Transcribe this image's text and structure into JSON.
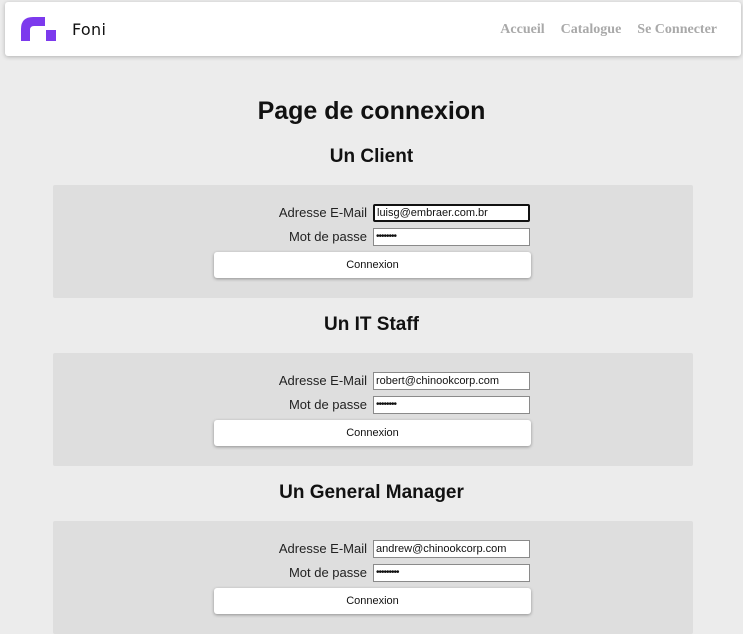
{
  "nav": {
    "brand": "Foni",
    "links": [
      "Accueil",
      "Catalogue",
      "Se Connecter"
    ]
  },
  "page": {
    "title": "Page de connexion"
  },
  "sections": [
    {
      "title": "Un Client",
      "email_label": "Adresse E-Mail",
      "email_value": "luisg@embraer.com.br",
      "password_label": "Mot de passe",
      "password_value": "••••••••",
      "button_label": "Connexion"
    },
    {
      "title": "Un IT Staff",
      "email_label": "Adresse E-Mail",
      "email_value": "robert@chinookcorp.com",
      "password_label": "Mot de passe",
      "password_value": "••••••••",
      "button_label": "Connexion"
    },
    {
      "title": "Un General Manager",
      "email_label": "Adresse E-Mail",
      "email_value": "andrew@chinookcorp.com",
      "password_label": "Mot de passe",
      "password_value": "•••••••••",
      "button_label": "Connexion"
    }
  ],
  "colors": {
    "logo": "#7c3aed",
    "background": "#ececec",
    "panel": "#dedede",
    "nav_link": "#a9a9a9"
  },
  "icons": {
    "logo": "foni-logo-icon"
  }
}
